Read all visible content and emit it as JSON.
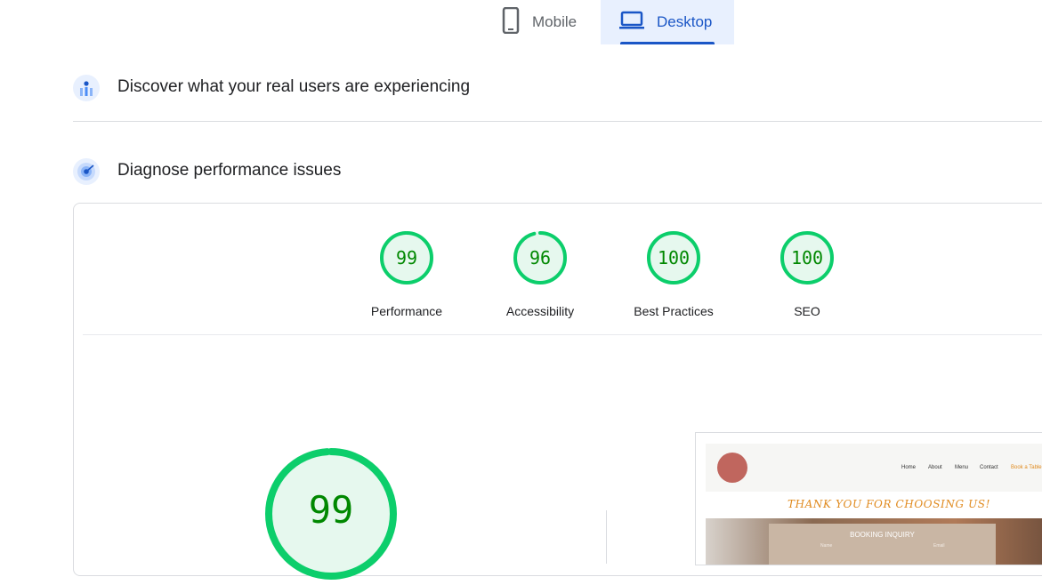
{
  "tabs": {
    "mobile_label": "Mobile",
    "desktop_label": "Desktop",
    "selected": "Desktop"
  },
  "sections": {
    "crux_title": "Discover what your real users are experiencing",
    "lighthouse_title": "Diagnose performance issues"
  },
  "scores": [
    {
      "value": "99",
      "label": "Performance",
      "score": 99
    },
    {
      "value": "96",
      "label": "Accessibility",
      "score": 96
    },
    {
      "value": "100",
      "label": "Best Practices",
      "score": 100
    },
    {
      "value": "100",
      "label": "SEO",
      "score": 100
    }
  ],
  "big_score": {
    "value": "99",
    "score": 99
  },
  "colors": {
    "pass_ring": "#0cce6b",
    "pass_fill": "#e6f8ee",
    "pass_text": "#008800",
    "accent": "#1a56c6"
  },
  "thumbnail": {
    "nav": [
      "Home",
      "About",
      "Menu",
      "Contact",
      "Book a Table"
    ],
    "thanks_text": "THANK YOU FOR CHOOSING US!",
    "form_title": "BOOKING INQUIRY",
    "field_name": "Name",
    "field_email": "Email"
  }
}
